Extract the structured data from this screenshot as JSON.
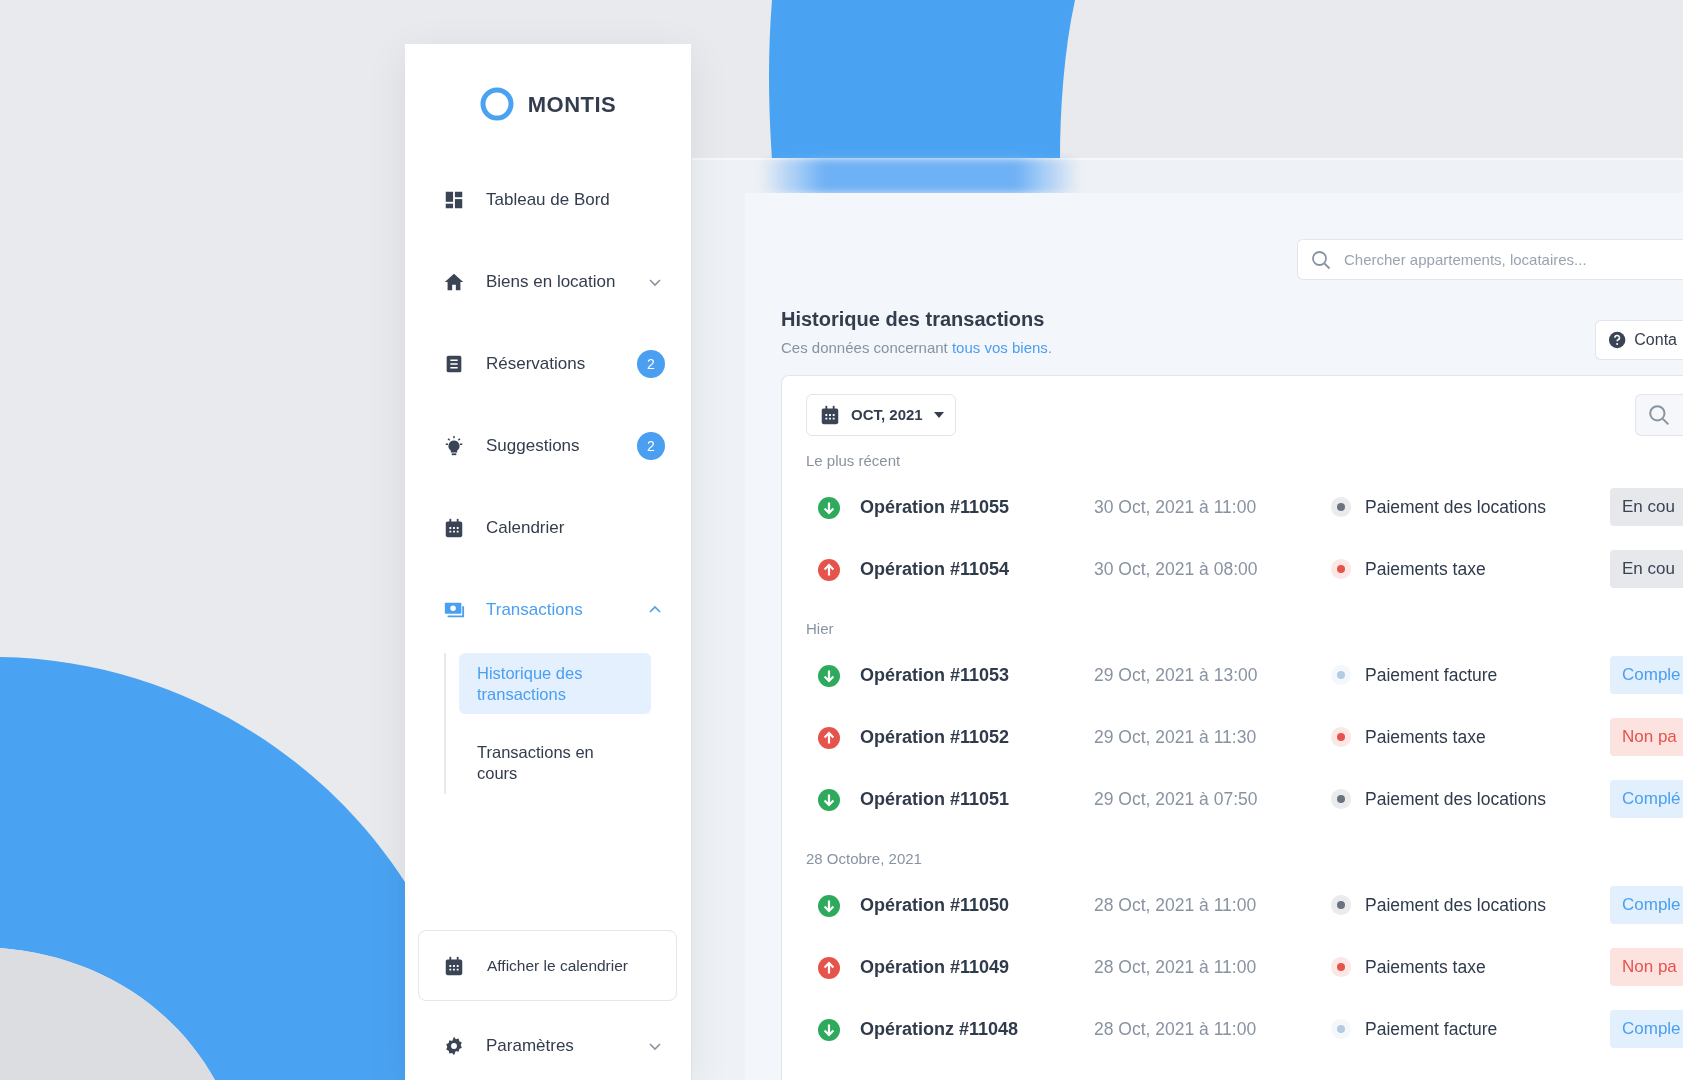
{
  "brand": {
    "name": "MONTIS"
  },
  "sidebar": {
    "items": [
      {
        "label": "Tableau de Bord",
        "selected": false
      },
      {
        "label": "Biens en location",
        "selected": false,
        "expanded": false
      },
      {
        "label": "Réservations",
        "selected": false,
        "badge": "2"
      },
      {
        "label": "Suggestions",
        "selected": false,
        "badge": "2"
      },
      {
        "label": "Calendrier",
        "selected": false
      },
      {
        "label": "Transactions",
        "selected": true,
        "expanded": true,
        "children": [
          {
            "label": "Historique des transactions",
            "selected": true
          },
          {
            "label": "Transactions en cours",
            "selected": false
          }
        ]
      }
    ],
    "calendar_button": "Afficher le calendrier",
    "settings": {
      "label": "Paramètres",
      "expanded": false
    }
  },
  "search": {
    "placeholder": "Chercher appartements, locataires..."
  },
  "header": {
    "title": "Historique des transactions",
    "subtitle_before": "Ces données concernant ",
    "subtitle_link": "tous vos biens",
    "subtitle_after": ".",
    "contact_button": "Conta"
  },
  "period_button": "OCT, 2021",
  "groups": [
    {
      "heading": "Le plus récent",
      "transactions": [
        {
          "kind": "incoming",
          "name": "Opération #11055",
          "date": "30 Oct, 2021 à 11:00",
          "category": "Paiement des locations",
          "color": "#6b7280",
          "status": {
            "kind": "ongoing",
            "label": "En cou"
          }
        },
        {
          "kind": "outgoing",
          "name": "Opération #11054",
          "date": "30 Oct, 2021 à 08:00",
          "category": "Paiements taxe",
          "color": "#e5534b",
          "status": {
            "kind": "ongoing",
            "label": "En cou"
          }
        }
      ]
    },
    {
      "heading": "Hier",
      "transactions": [
        {
          "kind": "incoming",
          "name": "Opération #11053",
          "date": "29 Oct, 2021 à 13:00",
          "category": "Paiement facture",
          "color": "#b4cbe3",
          "status": {
            "kind": "complete",
            "label": "Comple"
          }
        },
        {
          "kind": "outgoing",
          "name": "Opération #11052",
          "date": "29 Oct, 2021 à 11:30",
          "category": "Paiements taxe",
          "color": "#e5534b",
          "status": {
            "kind": "unpaid",
            "label": "Non pa"
          }
        },
        {
          "kind": "incoming",
          "name": "Opération #11051",
          "date": "29 Oct, 2021 à 07:50",
          "category": "Paiement des locations",
          "color": "#6b7280",
          "status": {
            "kind": "complete",
            "label": "Complé"
          }
        }
      ]
    },
    {
      "heading": "28 Octobre, 2021",
      "transactions": [
        {
          "kind": "incoming",
          "name": "Opération #11050",
          "date": "28 Oct, 2021 à 11:00",
          "category": "Paiement des locations",
          "color": "#6b7280",
          "status": {
            "kind": "complete",
            "label": "Comple"
          }
        },
        {
          "kind": "outgoing",
          "name": "Opération #11049",
          "date": "28 Oct, 2021 à 11:00",
          "category": "Paiements taxe",
          "color": "#e5534b",
          "status": {
            "kind": "unpaid",
            "label": "Non pa"
          }
        },
        {
          "kind": "incoming",
          "name": "Opérationz #11048",
          "date": "28 Oct, 2021 à 11:00",
          "category": "Paiement facture",
          "color": "#b4cbe3",
          "status": {
            "kind": "complete",
            "label": "Comple"
          }
        }
      ]
    }
  ]
}
